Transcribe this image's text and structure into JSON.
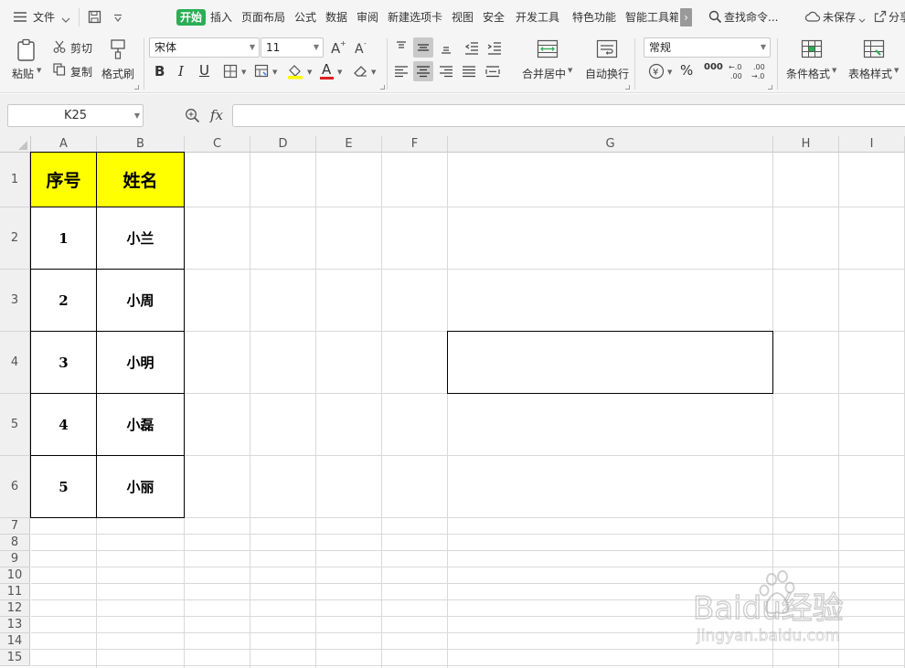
{
  "menu": {
    "file": "文件",
    "tabs": [
      "开始",
      "插入",
      "页面布局",
      "公式",
      "数据",
      "审阅",
      "新建选项卡",
      "视图",
      "安全",
      "开发工具",
      "特色功能",
      "智能工具箱"
    ],
    "search": "查找命令...",
    "unsaved": "未保存",
    "share": "分享"
  },
  "ribbon": {
    "paste": "粘贴",
    "cut": "剪切",
    "copy": "复制",
    "format_painter": "格式刷",
    "font_name": "宋体",
    "font_size": "11",
    "bold": "B",
    "italic": "I",
    "underline": "U",
    "font_color_letter": "A",
    "merge_center": "合并居中",
    "wrap_text": "自动换行",
    "number_format": "常规",
    "percent": "%",
    "thousands": "000",
    "inc_decimal": "+.0\n.00",
    "dec_decimal": ".00\n→.0",
    "conditional_format": "条件格式",
    "table_style": "表格样式"
  },
  "formula_bar": {
    "name_box": "K25",
    "fx": "fx",
    "value": ""
  },
  "columns": [
    "A",
    "B",
    "C",
    "D",
    "E",
    "F",
    "G",
    "H",
    "I"
  ],
  "rows": [
    "1",
    "2",
    "3",
    "4",
    "5",
    "6",
    "7",
    "8",
    "9",
    "10",
    "11",
    "12",
    "13",
    "14",
    "15"
  ],
  "table": {
    "header": [
      "序号",
      "姓名"
    ],
    "rows": [
      [
        "1",
        "小兰"
      ],
      [
        "2",
        "小周"
      ],
      [
        "3",
        "小明"
      ],
      [
        "4",
        "小磊"
      ],
      [
        "5",
        "小丽"
      ]
    ],
    "header_color": "#ffff00"
  },
  "watermark": {
    "text": "Baidu经验",
    "url": "jingyan.baidu.com"
  },
  "colors": {
    "accent_green": "#2bae55",
    "font_color_bar": "#e02020",
    "fill_color_bar": "#ffff00"
  }
}
